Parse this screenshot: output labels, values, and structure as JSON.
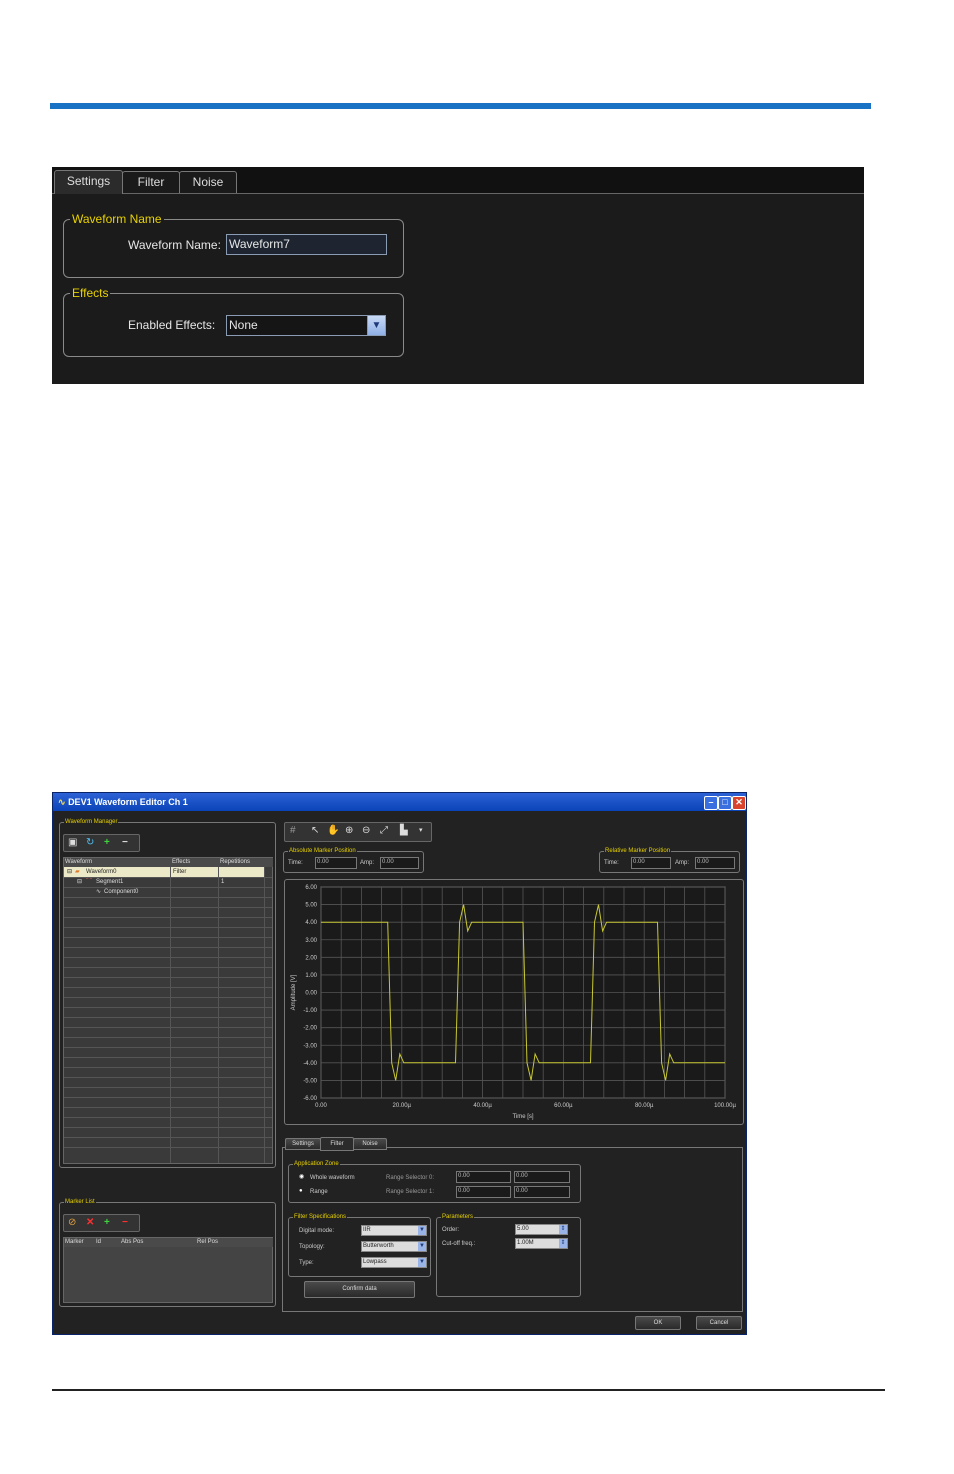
{
  "settings_panel": {
    "tabs": [
      "Settings",
      "Filter",
      "Noise"
    ],
    "waveform_group": {
      "legend": "Waveform Name",
      "label": "Waveform Name:",
      "value": "Waveform7"
    },
    "effects_group": {
      "legend": "Effects",
      "label": "Enabled Effects:",
      "selected": "None"
    }
  },
  "editor": {
    "window_title": "DEV1 Waveform Editor Ch 1",
    "waveform_manager": {
      "legend": "Waveform Manager",
      "columns": [
        "Waveform",
        "Effects",
        "Repetitions"
      ],
      "rows": [
        {
          "name": "Waveform0",
          "effects": "Filter",
          "repetitions": ""
        },
        {
          "name": "Segment1",
          "effects": "",
          "repetitions": "1"
        },
        {
          "name": "Component0",
          "effects": "",
          "repetitions": ""
        }
      ]
    },
    "marker_list": {
      "legend": "Marker List",
      "columns": [
        "Marker",
        "Id",
        "Abs Pos",
        "Rel Pos"
      ]
    },
    "absolute_marker": {
      "legend": "Absolute Marker Position",
      "time_label": "Time:",
      "time_value": "0.00",
      "amp_label": "Amp:",
      "amp_value": "0.00"
    },
    "relative_marker": {
      "legend": "Relative Marker Position",
      "time_label": "Time:",
      "time_value": "0.00",
      "amp_label": "Amp:",
      "amp_value": "0.00"
    },
    "chart_data": {
      "type": "line",
      "xlabel": "Time [s]",
      "ylabel": "Amplitude [V]",
      "xlim": [
        0,
        100
      ],
      "ylim": [
        -6,
        6
      ],
      "x_ticks": [
        "0.00",
        "20.00µ",
        "40.00µ",
        "60.00µ",
        "80.00µ",
        "100.00µ"
      ],
      "y_ticks": [
        "6.00",
        "5.00",
        "4.00",
        "3.00",
        "2.00",
        "1.00",
        "0.00",
        "-1.00",
        "-2.00",
        "-3.00",
        "-4.00",
        "-5.00",
        "-6.00"
      ],
      "series": [
        {
          "color": "#c8c832",
          "x": [
            0,
            16.5,
            17.5,
            18.5,
            19.5,
            20.5,
            33.3,
            34.3,
            35.3,
            36.3,
            37.3,
            50,
            51,
            52,
            53,
            54,
            66.7,
            67.7,
            68.7,
            69.7,
            70.7,
            83.3,
            84.3,
            85.3,
            86.3,
            87.3,
            100
          ],
          "y": [
            4,
            4,
            -4,
            -5,
            -3.5,
            -4,
            -4,
            4,
            5,
            3.5,
            4,
            4,
            -4,
            -5,
            -3.5,
            -4,
            -4,
            4,
            5,
            3.5,
            4,
            4,
            -4,
            -5,
            -3.5,
            -4,
            -4
          ]
        }
      ]
    },
    "lower_tabs": [
      "Settings",
      "Filter",
      "Noise"
    ],
    "application_zone": {
      "legend": "Application Zone",
      "whole": "Whole waveform",
      "range": "Range",
      "rs0_label": "Range Selector 0:",
      "rs1_label": "Range Selector 1:",
      "rs0_a": "0.00",
      "rs0_b": "0.00",
      "rs1_a": "0.00",
      "rs1_b": "0.00"
    },
    "filter_spec": {
      "legend": "Filter Specifications",
      "digital_mode_label": "Digital mode:",
      "digital_mode": "IIR",
      "topology_label": "Topology:",
      "topology": "Butterworth",
      "type_label": "Type:",
      "type": "Lowpass"
    },
    "parameters": {
      "legend": "Parameters",
      "order_label": "Order:",
      "order": "5.00",
      "cutoff_label": "Cut-off freq.:",
      "cutoff": "1.00M"
    },
    "confirm": "Confirm data",
    "ok": "OK",
    "cancel": "Cancel"
  }
}
